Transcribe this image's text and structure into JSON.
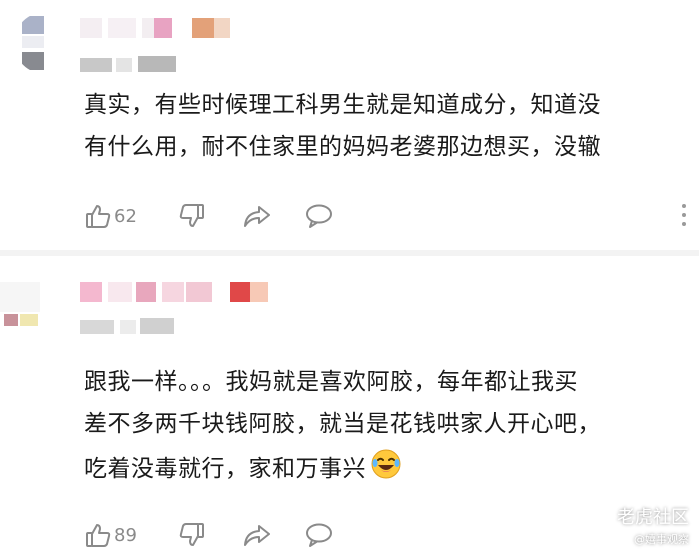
{
  "comments": [
    {
      "text_lines": [
        "真实，有些时候理工科男生就是知道成分，知道没",
        "有什么用，耐不住家里的妈妈老婆那边想买，没辙"
      ],
      "like_count": "62"
    },
    {
      "text_lines": [
        "跟我一样。。。我妈就是喜欢阿胶，每年都让我买",
        "差不多两千块钱阿胶，就当是花钱哄家人开心吧，",
        "吃着没毒就行，家和万事兴"
      ],
      "like_count": "89"
    }
  ],
  "icons": [
    "thumbs-up-icon",
    "thumbs-down-icon",
    "share-icon",
    "comment-icon",
    "more-icon",
    "laughing-emoji-icon"
  ],
  "watermark": {
    "brand": "老虎社区",
    "sub": "@嬉事观察"
  },
  "colors": {
    "text": "#1a1a1a",
    "icon_gray": "#8a8a8a",
    "divider": "#f3f3f3"
  }
}
